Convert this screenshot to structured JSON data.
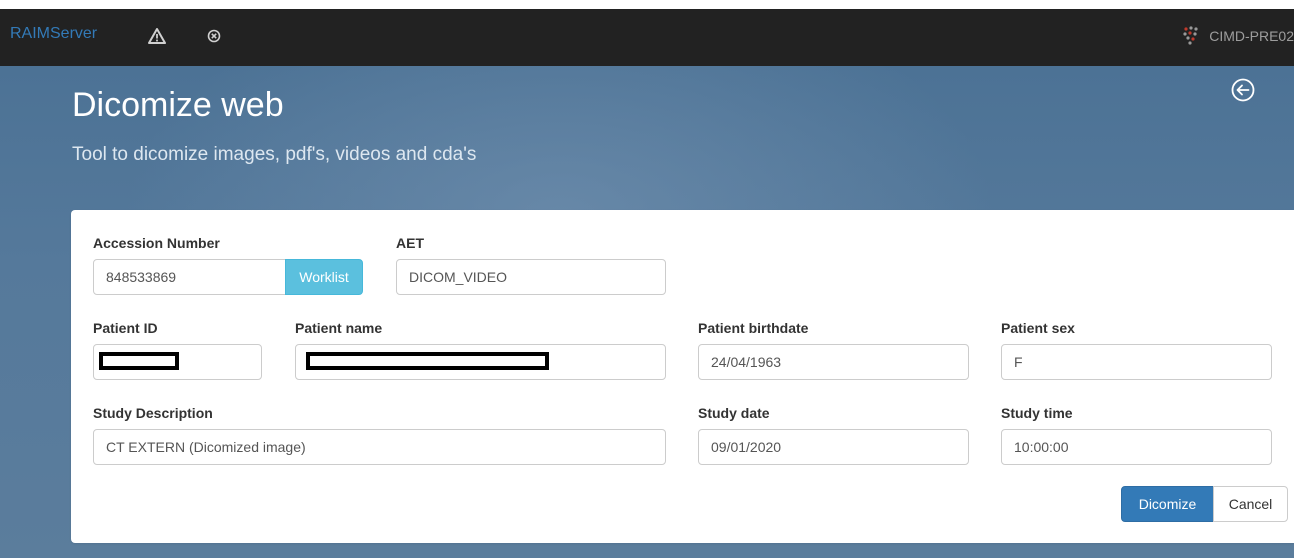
{
  "navbar": {
    "brand": "RAIMServer",
    "warning_icon": "warning-triangle-icon",
    "error_icon": "circle-x-icon",
    "server_icon": "hospital-logo-icon",
    "server_name": "CIMD-PRE02"
  },
  "hero": {
    "title": "Dicomize web",
    "subtitle": "Tool to dicomize images, pdf's, videos and cda's",
    "back_icon": "circle-arrow-left-icon"
  },
  "form": {
    "accession_number": {
      "label": "Accession Number",
      "value": "848533869"
    },
    "worklist_label": "Worklist",
    "aet": {
      "label": "AET",
      "value": "DICOM_VIDEO"
    },
    "patient_id": {
      "label": "Patient ID",
      "value": ""
    },
    "patient_name": {
      "label": "Patient name",
      "value": ""
    },
    "patient_birthdate": {
      "label": "Patient birthdate",
      "value": "24/04/1963"
    },
    "patient_sex": {
      "label": "Patient sex",
      "value": "F"
    },
    "study_description": {
      "label": "Study Description",
      "value": "CT EXTERN (Dicomized image)"
    },
    "study_date": {
      "label": "Study date",
      "value": "09/01/2020"
    },
    "study_time": {
      "label": "Study time",
      "value": "10:00:00"
    },
    "dicomize_label": "Dicomize",
    "cancel_label": "Cancel"
  },
  "colors": {
    "navbar_bg": "#222222",
    "brand": "#337ab7",
    "primary": "#337ab7",
    "info": "#5bc0de"
  }
}
